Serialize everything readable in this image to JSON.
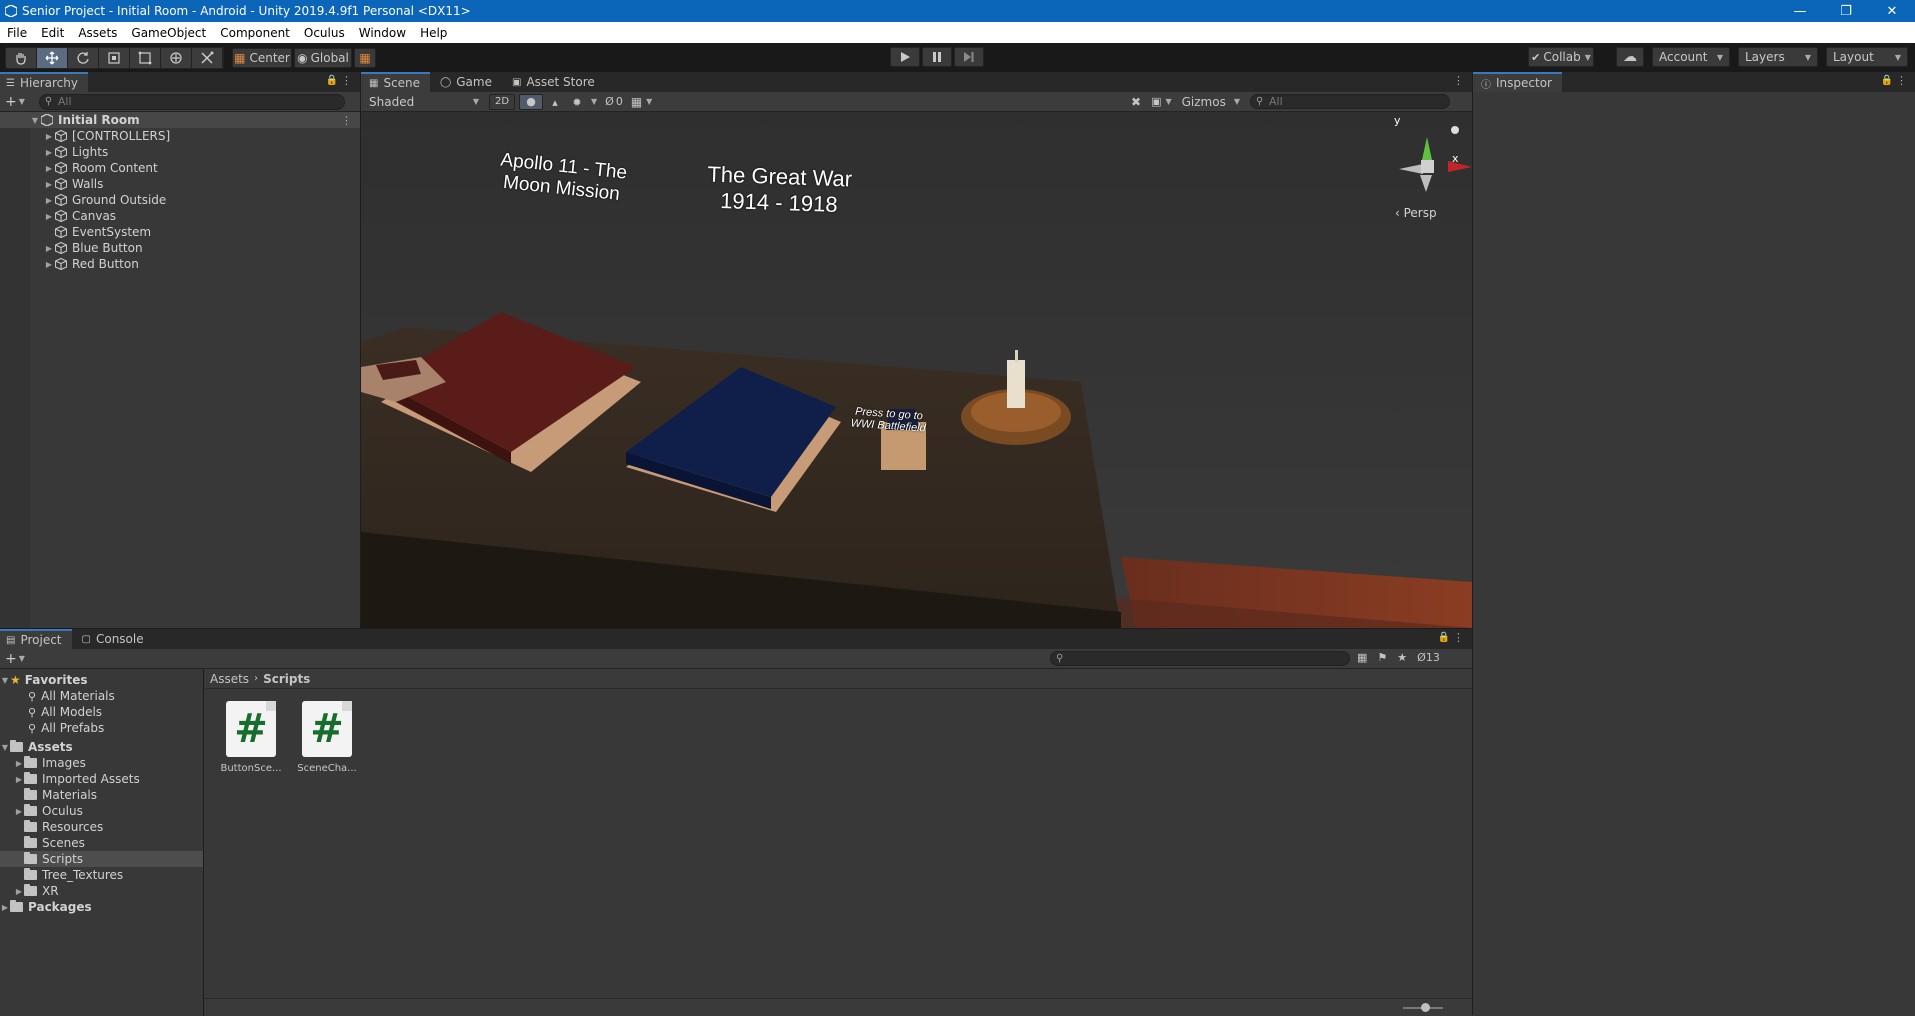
{
  "window": {
    "title": "Senior Project - Initial Room - Android - Unity 2019.4.9f1 Personal <DX11>",
    "controls": [
      "—",
      "❐",
      "✕"
    ]
  },
  "menu": [
    "File",
    "Edit",
    "Assets",
    "GameObject",
    "Component",
    "Oculus",
    "Window",
    "Help"
  ],
  "toolbar": {
    "pivot_label": "Center",
    "space_label": "Global",
    "collab_label": "Collab",
    "account_label": "Account",
    "layers_label": "Layers",
    "layout_label": "Layout"
  },
  "hierarchy": {
    "tab_label": "Hierarchy",
    "search_placeholder": "All",
    "scene_name": "Initial Room",
    "items": [
      {
        "label": "[CONTROLLERS]",
        "expandable": true
      },
      {
        "label": "Lights",
        "expandable": true
      },
      {
        "label": "Room Content",
        "expandable": true
      },
      {
        "label": "Walls",
        "expandable": true
      },
      {
        "label": "Ground Outside",
        "expandable": true
      },
      {
        "label": "Canvas",
        "expandable": true
      },
      {
        "label": "EventSystem",
        "expandable": false
      },
      {
        "label": "Blue Button",
        "expandable": true
      },
      {
        "label": "Red Button",
        "expandable": true
      }
    ]
  },
  "scene": {
    "tabs": [
      "Scene",
      "Game",
      "Asset Store"
    ],
    "shading_mode": "Shaded",
    "mode_2d": "2D",
    "fx_count": "0",
    "gizmos_label": "Gizmos",
    "search_placeholder": "All",
    "persp_label": "‹ Persp",
    "axis_y": "y",
    "axis_x": "x",
    "world_text": {
      "apollo_line1": "Apollo 11 - The",
      "apollo_line2": "Moon Mission",
      "war_line1": "The Great War",
      "war_line2": "1914 - 1918",
      "button_line1": "Press to go to",
      "button_line2": "WWI Battlefield"
    }
  },
  "inspector": {
    "tab_label": "Inspector"
  },
  "project": {
    "tabs": [
      "Project",
      "Console"
    ],
    "hidden_count": "13",
    "breadcrumb_root": "Assets",
    "breadcrumb_current": "Scripts",
    "favorites_label": "Favorites",
    "favorites": [
      "All Materials",
      "All Models",
      "All Prefabs"
    ],
    "assets_label": "Assets",
    "folders": [
      {
        "label": "Images",
        "expandable": true
      },
      {
        "label": "Imported Assets",
        "expandable": true
      },
      {
        "label": "Materials",
        "expandable": false
      },
      {
        "label": "Oculus",
        "expandable": true
      },
      {
        "label": "Resources",
        "expandable": false
      },
      {
        "label": "Scenes",
        "expandable": false
      },
      {
        "label": "Scripts",
        "expandable": false,
        "selected": true
      },
      {
        "label": "Tree_Textures",
        "expandable": false
      },
      {
        "label": "XR",
        "expandable": true
      }
    ],
    "packages_label": "Packages",
    "files": [
      {
        "label": "ButtonSce...",
        "glyph": "#"
      },
      {
        "label": "SceneCha...",
        "glyph": "#"
      }
    ],
    "zoom_level": 0.55
  },
  "colors": {
    "title_bar": "#0b65b8",
    "selection": "#2c5d87",
    "script_icon": "#176d2d"
  }
}
